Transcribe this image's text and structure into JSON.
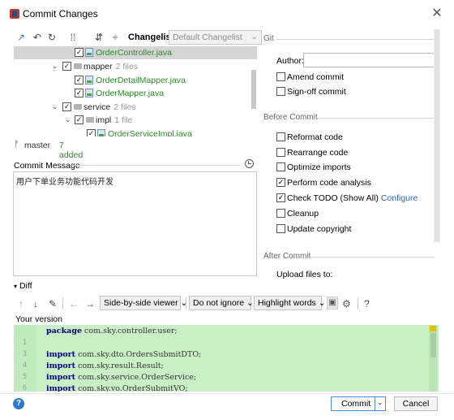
{
  "window": {
    "title": "Commit Changes",
    "close_glyph": "✕"
  },
  "toolbar": {
    "icons": [
      "arrow-in-icon",
      "undo-icon",
      "refresh-icon",
      "group-icon",
      "expand-all-icon",
      "collapse-all-icon"
    ],
    "changelist_label": "Changelist:",
    "changelist_value": "Default Changelist"
  },
  "tree": [
    {
      "label": "OrderController.java",
      "type": "file",
      "checked": true,
      "selected": true
    },
    {
      "label": "mapper",
      "count": "2 files",
      "type": "folder",
      "checked": true,
      "expanded": true
    },
    {
      "label": "OrderDetailMapper.java",
      "type": "file",
      "checked": true
    },
    {
      "label": "OrderMapper.java",
      "type": "file",
      "checked": true
    },
    {
      "label": "service",
      "count": "2 files",
      "type": "folder",
      "checked": true,
      "expanded": true
    },
    {
      "label": "impl",
      "count": "1 file",
      "type": "folder",
      "checked": true,
      "expanded": true
    },
    {
      "label": "OrderServiceImpl.java",
      "type": "file",
      "checked": true
    }
  ],
  "branch": {
    "name": "master",
    "added": "7 added"
  },
  "commit_message": {
    "label": "Commit Message",
    "value": "用户下单业务功能代码开发"
  },
  "git": {
    "section_title": "Git",
    "author_label": "Author:",
    "author_value": "",
    "amend_commit": {
      "label": "Amend commit",
      "checked": false
    },
    "sign_off_commit": {
      "label": "Sign-off commit",
      "checked": false
    }
  },
  "before_commit": {
    "section_title": "Before Commit",
    "options": [
      {
        "label": "Reformat code",
        "checked": false
      },
      {
        "label": "Rearrange code",
        "checked": false
      },
      {
        "label": "Optimize imports",
        "checked": false
      },
      {
        "label": "Perform code analysis",
        "checked": true
      },
      {
        "label": "Check TODO (Show All)",
        "checked": true,
        "link": "Configure"
      },
      {
        "label": "Cleanup",
        "checked": false
      },
      {
        "label": "Update copyright",
        "checked": false
      }
    ]
  },
  "after_commit": {
    "section_title": "After Commit",
    "upload_label": "Upload files to:"
  },
  "diff": {
    "header": "Diff",
    "viewer_select": "Side-by-side viewer",
    "ignore_select": "Do not ignore",
    "highlight_select": "Highlight words",
    "help_glyph": "?",
    "your_version_label": "Your version",
    "lines": [
      {
        "n": "",
        "kw": "package",
        "rest": " com.sky.controller.user;"
      },
      {
        "n": "1",
        "kw": "",
        "rest": ""
      },
      {
        "n": "3",
        "kw": "import",
        "rest": " com.sky.dto.OrdersSubmitDTO;"
      },
      {
        "n": "4",
        "kw": "import",
        "rest": " com.sky.result.Result;"
      },
      {
        "n": "5",
        "kw": "import",
        "rest": " com.sky.service.OrderService;"
      },
      {
        "n": "6",
        "kw": "import",
        "rest": " com.sky.vo.OrderSubmitVO;"
      }
    ]
  },
  "footer": {
    "help_glyph": "?",
    "commit_label": "Commit",
    "cancel_label": "Cancel"
  },
  "colors": {
    "accent": "#2f7ac8",
    "added_green": "#2a8a2a",
    "diff_bg": "#c9efc5"
  }
}
